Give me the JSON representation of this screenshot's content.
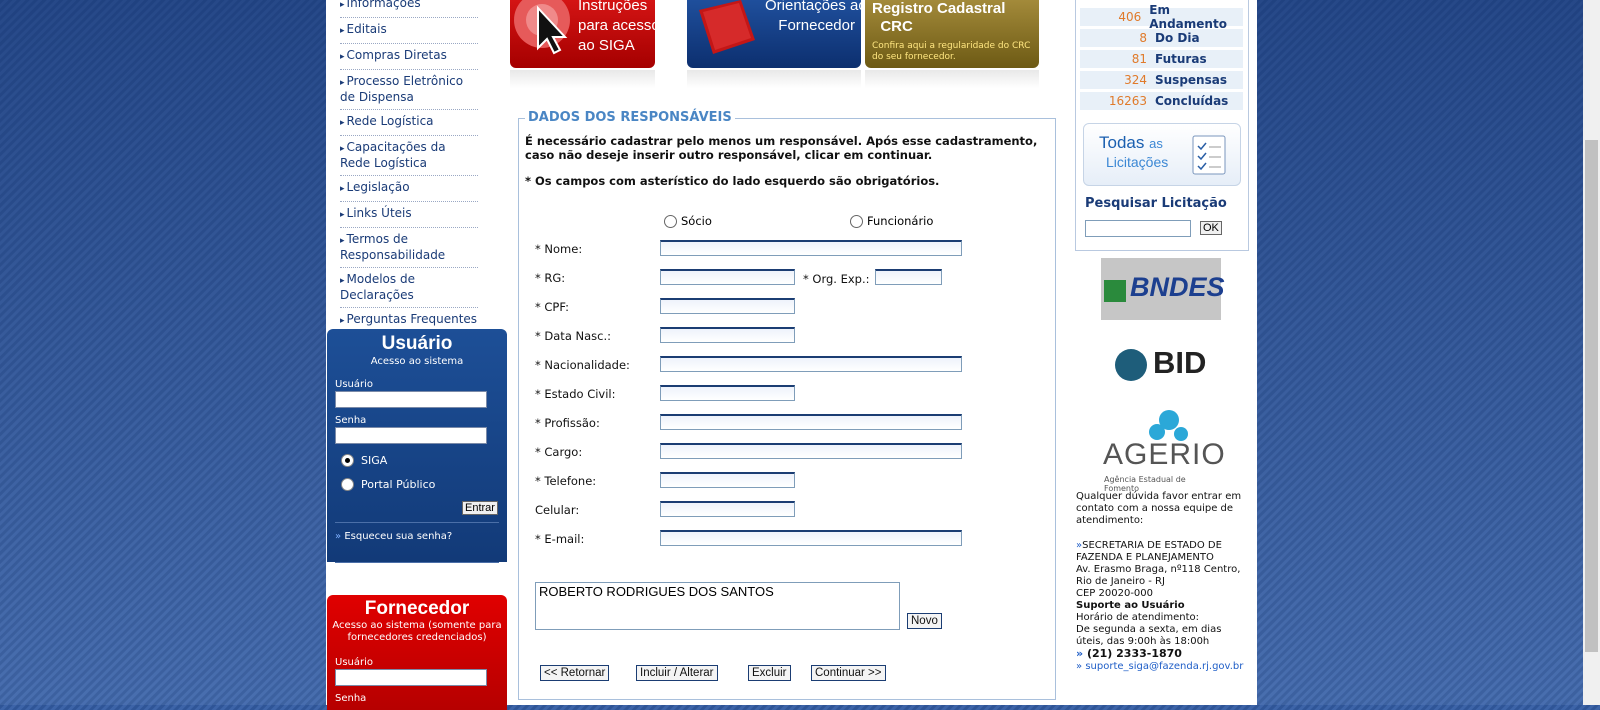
{
  "menu": [
    {
      "label": "Informações"
    },
    {
      "label": "Editais"
    },
    {
      "label": "Compras Diretas"
    },
    {
      "label": "Processo Eletrônico de Dispensa"
    },
    {
      "label": "Rede Logística"
    },
    {
      "label": "Capacitações da Rede Logística"
    },
    {
      "label": "Legislação"
    },
    {
      "label": "Links Úteis"
    },
    {
      "label": "Termos de Responsabilidade"
    },
    {
      "label": "Modelos de Declarações"
    },
    {
      "label": "Perguntas Frequentes"
    }
  ],
  "user_box": {
    "title": "Usuário",
    "subtitle": "Acesso ao sistema",
    "user_label": "Usuário",
    "pass_label": "Senha",
    "radio_siga": "SIGA",
    "radio_portal": "Portal Público",
    "enter": "Entrar",
    "forgot": "Esqueceu sua senha?"
  },
  "supplier_box": {
    "title": "Fornecedor",
    "subtitle": "Acesso ao sistema (somente para fornecedores credenciados)",
    "user_label": "Usuário",
    "pass_label": "Senha"
  },
  "banners": {
    "b1": "Instruções\npara acesso\nao SIGA",
    "b2": "Orientações ao\nFornecedor",
    "b3": "Registro Cadastral\n  CRC",
    "b3_desc": "Confira aqui a regularidade do CRC do seu fornecedor."
  },
  "form": {
    "legend": "DADOS DOS RESPONSÁVEIS",
    "note1": "É necessário cadastrar pelo menos um responsável. Após esse cadastramento, caso não deseje inserir outro responsável, clicar em continuar.",
    "note2": "* Os campos com asterístico do lado esquerdo são obrigatórios.",
    "radio_socio": "Sócio",
    "radio_func": "Funcionário",
    "labels": {
      "nome": "* Nome:",
      "rg": "* RG:",
      "org": "* Org. Exp.:",
      "cpf": "* CPF:",
      "nasc": "* Data Nasc.:",
      "nac": "* Nacionalidade:",
      "civil": "* Estado Civil:",
      "prof": "* Profissão:",
      "cargo": "* Cargo:",
      "tel": "* Telefone:",
      "cel": "Celular:",
      "email": "* E-mail:"
    },
    "list_value": "ROBERTO RODRIGUES DOS SANTOS",
    "btn_novo": "Novo",
    "btn_retornar": "<< Retornar",
    "btn_incluir": "Incluir / Alterar",
    "btn_excluir": "Excluir",
    "btn_continuar": "Continuar >>"
  },
  "stats": [
    {
      "count": "406",
      "label": "Em Andamento"
    },
    {
      "count": "8",
      "label": "Do Dia"
    },
    {
      "count": "81",
      "label": "Futuras"
    },
    {
      "count": "324",
      "label": "Suspensas"
    },
    {
      "count": "16263",
      "label": "Concluídas"
    }
  ],
  "todas": {
    "big": "Todas",
    "as": "as",
    "lic": "Licitações"
  },
  "search": {
    "label": "Pesquisar Licitação",
    "ok": "OK"
  },
  "logos": {
    "bndes": "BNDES",
    "bid": "BID",
    "agerio": "AGERIO",
    "agerio_sub": "Agência Estadual de Fomento"
  },
  "contact": {
    "intro": "Qualquer dúvida favor entrar em contato com a nossa equipe de atendimento:",
    "org": "SECRETARIA DE ESTADO DE FAZENDA E PLANEJAMENTO",
    "addr1": "Av. Erasmo Braga, nº118 Centro,",
    "addr2": "Rio de Janeiro - RJ",
    "cep": "CEP 20020-000",
    "support_title": "Suporte ao Usuário",
    "hours_title": "Horário de atendimento:",
    "hours": "De segunda a sexta, em dias úteis, das 9:00h às 18:00h",
    "phone": "(21) 2333-1870",
    "email": "suporte_siga@fazenda.rj.gov.br"
  }
}
